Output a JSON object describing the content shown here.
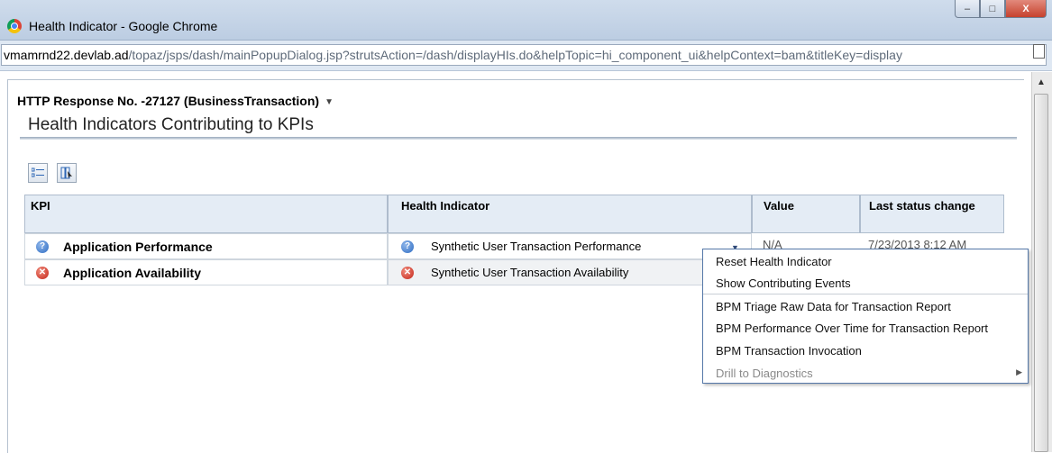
{
  "window": {
    "title": "Health Indicator - Google Chrome",
    "controls": {
      "minimize": "–",
      "maximize": "□",
      "close": "X"
    }
  },
  "address_bar": {
    "host": "vmamrnd22.devlab.ad",
    "path": "/topaz/jsps/dash/mainPopupDialog.jsp?strutsAction=/dash/displayHIs.do&helpTopic=hi_component_ui&helpContext=bam&titleKey=display"
  },
  "page": {
    "ci_title": "HTTP Response No. -27127 (BusinessTransaction)",
    "section_title": "Health Indicators Contributing to KPIs"
  },
  "table": {
    "headers": {
      "kpi": "KPI",
      "health_indicator": "Health Indicator",
      "value": "Value",
      "last_status_change": "Last status change"
    },
    "rows": [
      {
        "kpi": "Application Performance",
        "kpi_status": "unknown",
        "health_indicator": "Synthetic User Transaction Performance",
        "hi_status": "unknown",
        "value": "N/A",
        "last_status_change": "7/23/2013 8:12 AM"
      },
      {
        "kpi": "Application Availability",
        "kpi_status": "critical",
        "health_indicator": "Synthetic User Transaction Availability",
        "hi_status": "critical",
        "value": "",
        "last_status_change": ""
      }
    ]
  },
  "context_menu": {
    "items": [
      "Reset Health Indicator",
      "Show Contributing Events",
      "BPM Triage Raw Data for Transaction Report",
      "BPM Performance Over Time for Transaction Report",
      "BPM Transaction Invocation",
      "Drill to Diagnostics"
    ]
  },
  "colors": {
    "status_unknown": "#2f6dc3",
    "status_critical": "#c4261a",
    "header_bg": "#e4ecf5",
    "menu_border": "#5578a8"
  }
}
